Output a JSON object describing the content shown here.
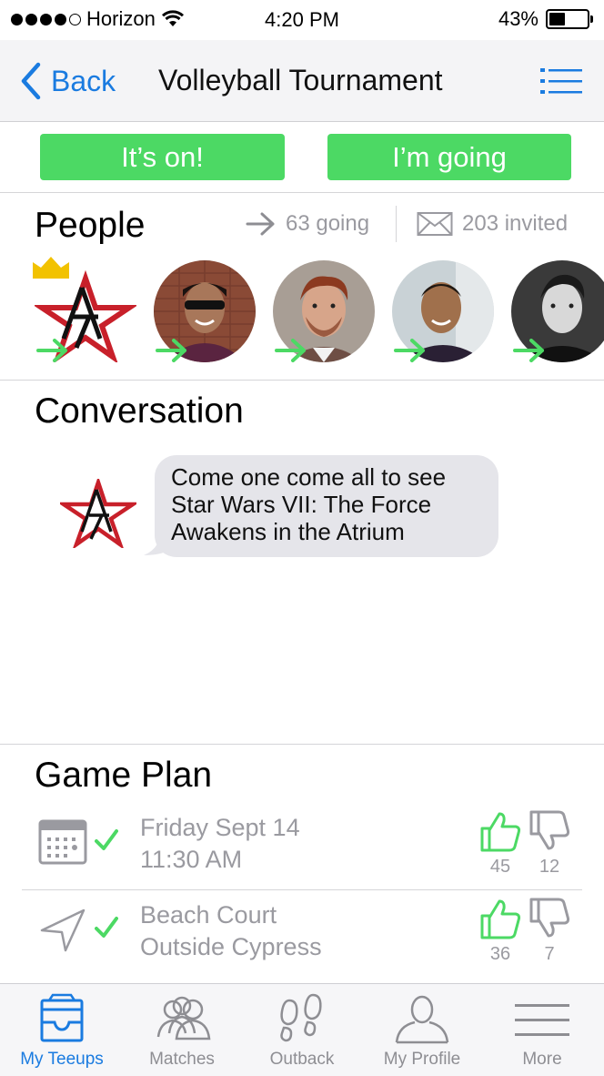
{
  "status_bar": {
    "carrier": "Horizon",
    "time": "4:20 PM",
    "battery_percent_label": "43%",
    "battery_level": 0.43,
    "signal_bars_filled": 4,
    "signal_bars_total": 5
  },
  "nav": {
    "back_label": "Back",
    "title": "Volleyball Tournament",
    "menu_icon": "list-icon"
  },
  "actions": {
    "primary_label": "It’s on!",
    "secondary_label": "I’m going"
  },
  "people": {
    "title": "People",
    "going_label": "63 going",
    "invited_label": "203 invited",
    "members": [
      {
        "name": "organizer-logo",
        "is_host": true
      },
      {
        "name": "person-1"
      },
      {
        "name": "person-2"
      },
      {
        "name": "person-3"
      },
      {
        "name": "person-4"
      }
    ]
  },
  "conversation": {
    "title": "Conversation",
    "messages": [
      {
        "line1": "Come one come all to see",
        "line2": "Star Wars VII: The Force",
        "line3": "Awakens in the Atrium"
      }
    ]
  },
  "game_plan": {
    "title": "Game Plan",
    "items": [
      {
        "line1": "Friday Sept 14",
        "line2": "11:30 AM",
        "icon": "calendar-icon",
        "up_votes": "45",
        "down_votes": "12"
      },
      {
        "line1": "Beach Court",
        "line2": "Outside Cypress",
        "icon": "location-arrow-icon",
        "up_votes": "36",
        "down_votes": "7"
      }
    ]
  },
  "tabs": [
    {
      "label": "My Teeups",
      "icon": "inbox-icon",
      "active": true
    },
    {
      "label": "Matches",
      "icon": "group-icon"
    },
    {
      "label": "Outback",
      "icon": "footprints-icon"
    },
    {
      "label": "My Profile",
      "icon": "person-icon"
    },
    {
      "label": "More",
      "icon": "hamburger-icon"
    }
  ],
  "colors": {
    "accent_blue": "#1a7be0",
    "green": "#4cd964",
    "gray_text": "#9a9aa0",
    "logo_red": "#c8202a"
  }
}
